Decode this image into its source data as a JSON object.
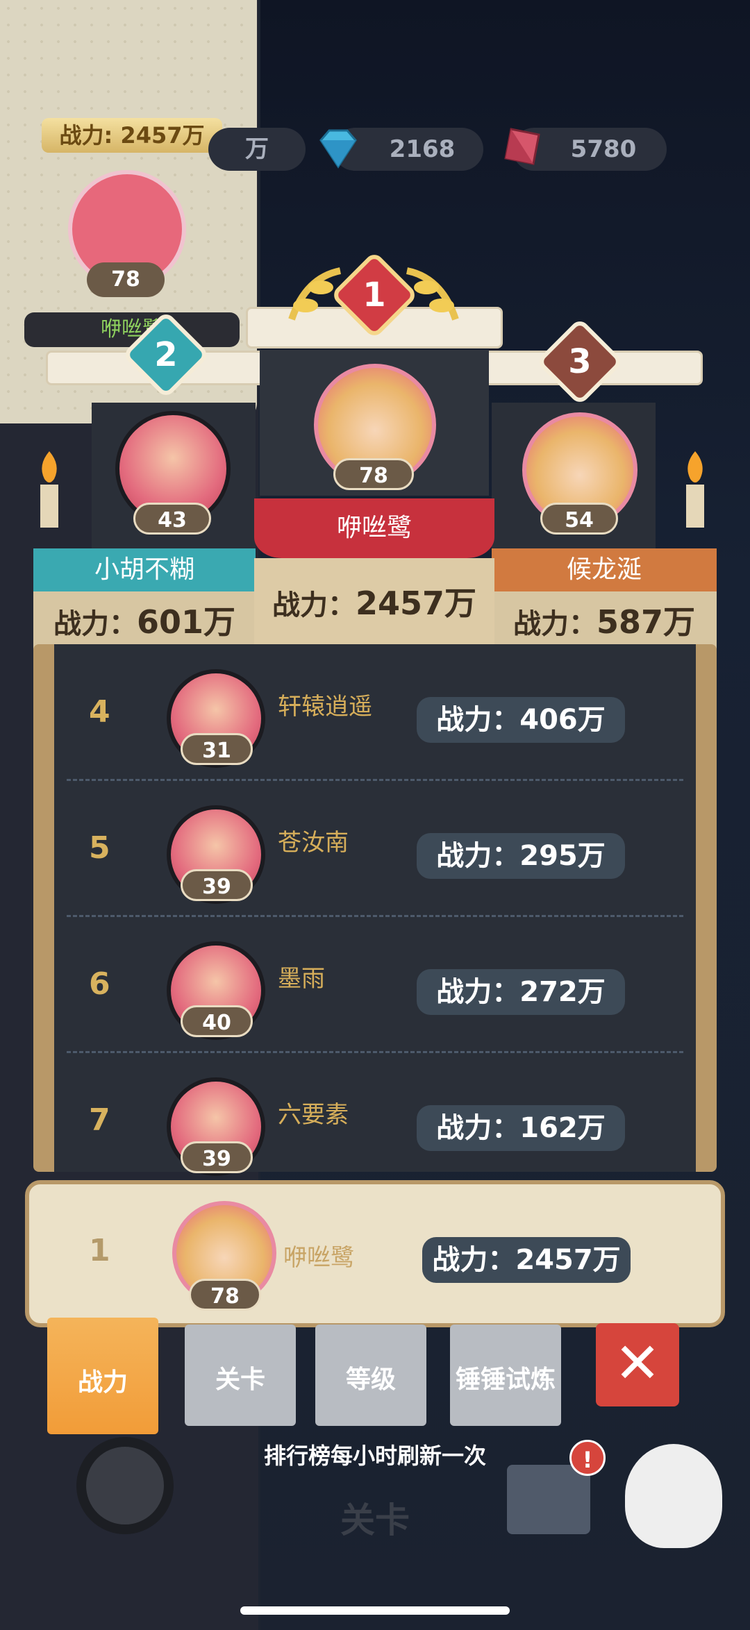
{
  "background_panel": {
    "power_label": "战力: 2457万",
    "level": "78",
    "name": "咿咝鹭"
  },
  "currency": {
    "partial_value": "万",
    "gems": "2168",
    "crystals": "5780"
  },
  "podium": {
    "first": {
      "rank": "1",
      "level": "78",
      "name": "咿咝鹭",
      "power_label": "战力：",
      "power_value": "2457万"
    },
    "second": {
      "rank": "2",
      "level": "43",
      "name": "小胡不糊",
      "power_label": "战力：",
      "power_value": "601万"
    },
    "third": {
      "rank": "3",
      "level": "54",
      "name": "候龙涎",
      "power_label": "战力：",
      "power_value": "587万"
    }
  },
  "ranking_list": [
    {
      "rank": "4",
      "level": "31",
      "name": "轩辕逍遥",
      "power": "战力：406万"
    },
    {
      "rank": "5",
      "level": "39",
      "name": "苍汝南",
      "power": "战力：295万"
    },
    {
      "rank": "6",
      "level": "40",
      "name": "墨雨",
      "power": "战力：272万"
    },
    {
      "rank": "7",
      "level": "39",
      "name": "六要素",
      "power": "战力：162万"
    }
  ],
  "my_row": {
    "rank": "1",
    "level": "78",
    "name": "咿咝鹭",
    "power": "战力：2457万"
  },
  "tabs": [
    "战力",
    "关卡",
    "等级",
    "锤锤试炼"
  ],
  "close_label": "✕",
  "footer": "排行榜每小时刷新一次",
  "bottom": {
    "level_text": "关卡",
    "badge": "!"
  },
  "colors": {
    "second_banner": "#3aa9b1",
    "first_banner": "#c7313d",
    "third_banner": "#d17a40",
    "active_tab": "#f2a444",
    "inactive_tab": "#b8bcc2"
  }
}
